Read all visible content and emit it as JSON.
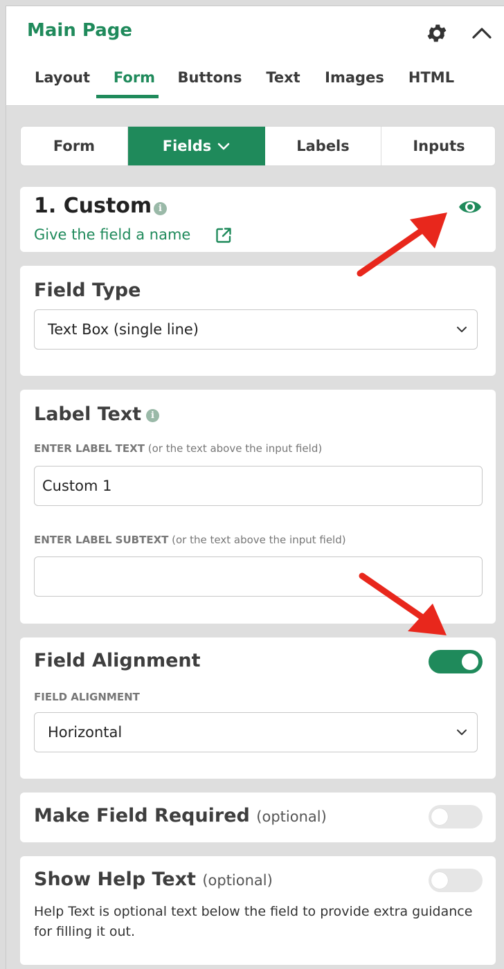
{
  "header": {
    "title": "Main Page",
    "tabs": [
      {
        "label": "Layout"
      },
      {
        "label": "Form"
      },
      {
        "label": "Buttons"
      },
      {
        "label": "Text"
      },
      {
        "label": "Images"
      },
      {
        "label": "HTML"
      }
    ],
    "active_tab": "Form",
    "icons": [
      "gear-icon",
      "chevron-up-icon"
    ]
  },
  "subtabs": {
    "items": [
      {
        "label": "Form"
      },
      {
        "label": "Fields"
      },
      {
        "label": "Labels"
      },
      {
        "label": "Inputs"
      }
    ],
    "active": "Fields"
  },
  "field": {
    "title": "1. Custom",
    "rename_link": "Give the field a name"
  },
  "field_type": {
    "heading": "Field Type",
    "selected": "Text Box (single line)"
  },
  "label_text": {
    "heading": "Label Text",
    "label_caption_bold": "ENTER LABEL TEXT",
    "label_caption_rest": "(or the text above the input field)",
    "label_value": "Custom 1",
    "subtext_caption_bold": "ENTER LABEL SUBTEXT",
    "subtext_caption_rest": "(or the text above the input field)",
    "subtext_value": ""
  },
  "field_alignment": {
    "heading": "Field Alignment",
    "toggle_on": true,
    "caption": "FIELD ALIGNMENT",
    "selected": "Horizontal"
  },
  "required": {
    "heading": "Make Field Required",
    "optional": "(optional)",
    "toggle_on": false
  },
  "help_text": {
    "heading": "Show Help Text",
    "optional": "(optional)",
    "toggle_on": false,
    "description": "Help Text is optional text below the field to provide extra guidance for filling it out."
  },
  "colors": {
    "accent": "#1f8a5b",
    "arrow": "#e8271c",
    "background": "#dedede"
  }
}
